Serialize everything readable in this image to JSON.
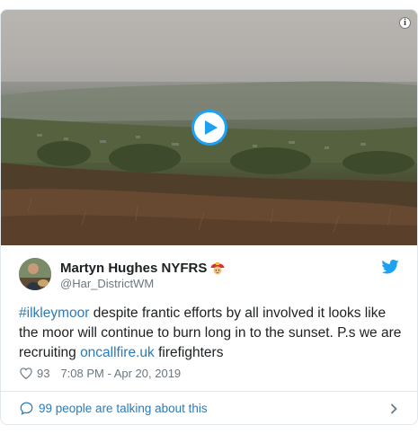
{
  "tweet": {
    "author": {
      "display_name": "Martyn Hughes NYFRS",
      "handle": "@Har_DistrictWM",
      "emoji_icon": "firefighter-emoji"
    },
    "text": {
      "hashtag": "#ilkleymoor",
      "body_1": " despite frantic efforts by all involved it looks like the moor will continue to burn long in to the sunset. P.s we are recruiting ",
      "link": "oncallfire.uk",
      "body_2": " firefighters"
    },
    "likes": "93",
    "timestamp": "7:08 PM - Apr 20, 2019",
    "talking": "99 people are talking about this"
  },
  "colors": {
    "accent": "#1da1f2",
    "link": "#2b7bb9",
    "muted": "#697882",
    "border": "#e1e8ed"
  },
  "icons": {
    "play": "play-icon",
    "info": "info-icon",
    "brand": "twitter-bird-icon",
    "like": "heart-icon",
    "reply": "speech-bubble-icon",
    "more": "chevron-right-icon"
  }
}
